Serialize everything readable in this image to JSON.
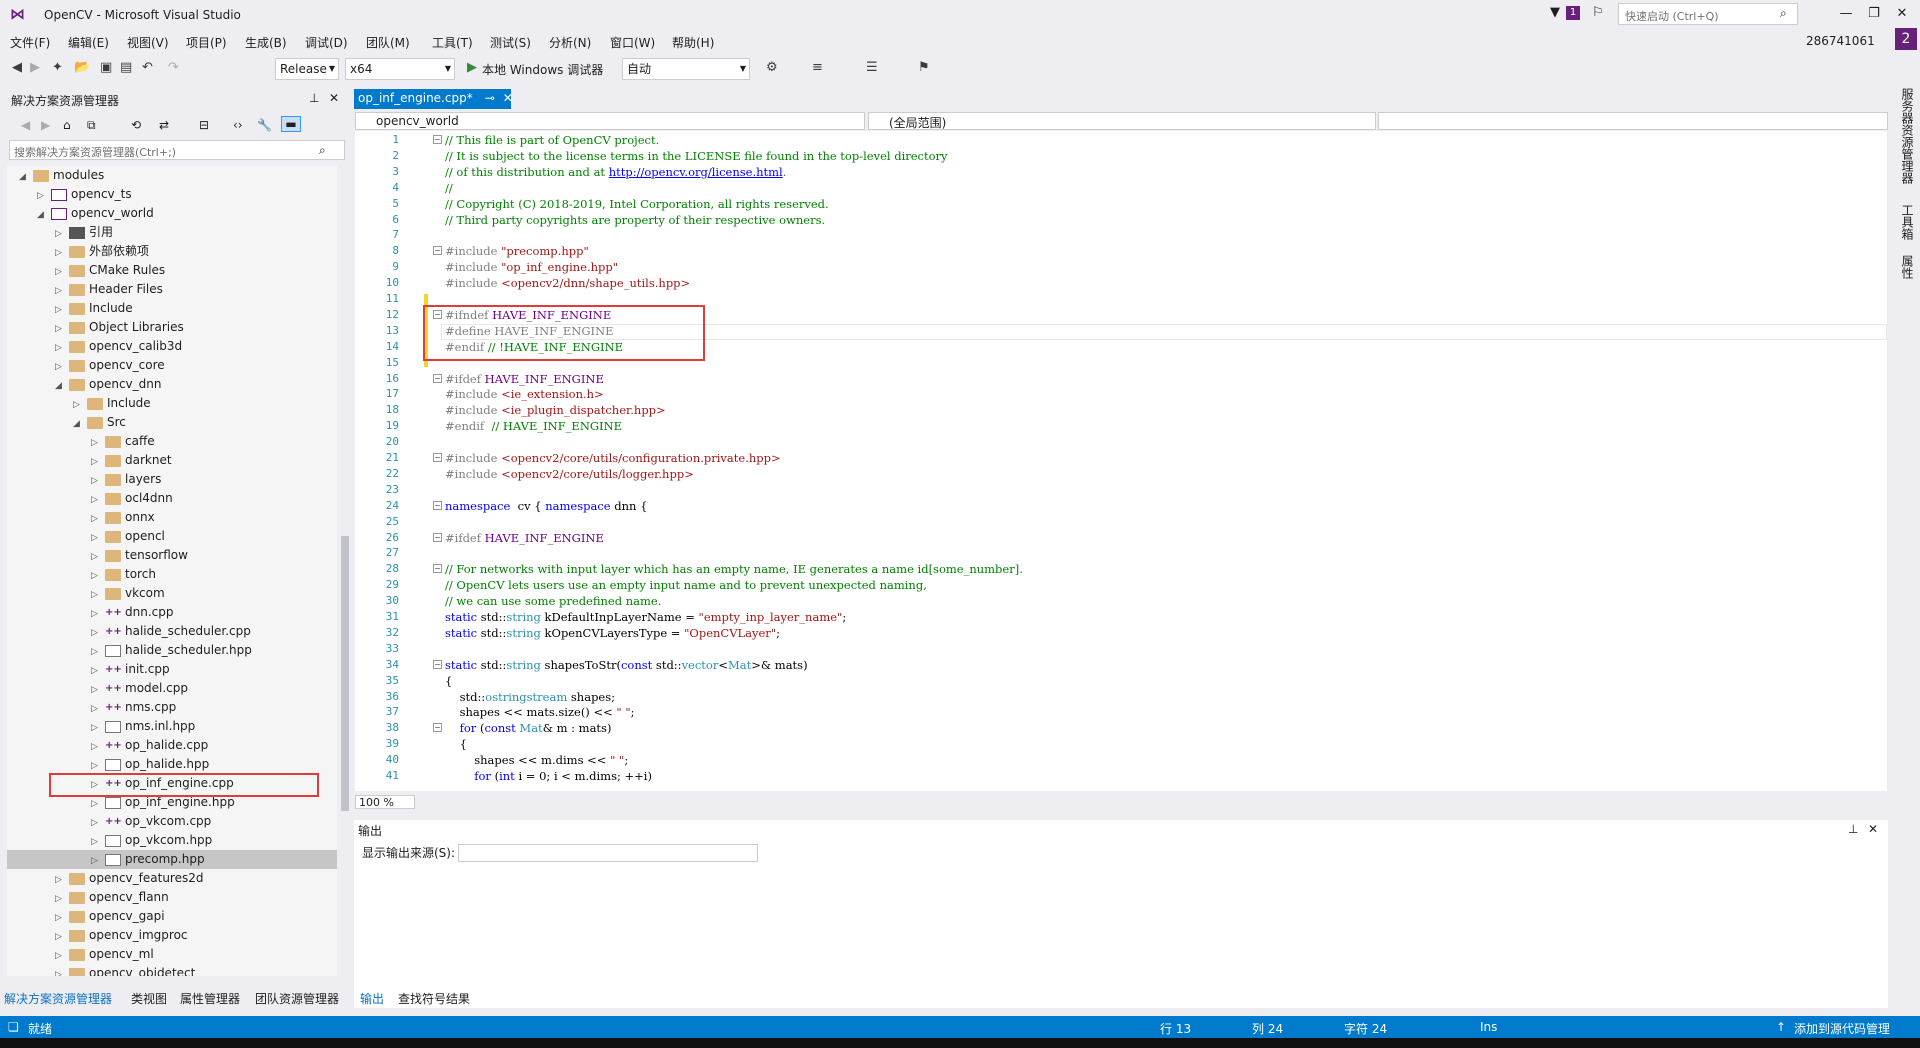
{
  "window": {
    "title": "OpenCV - Microsoft Visual Studio",
    "filter_badge": "1",
    "quick_launch_placeholder": "快速启动 (Ctrl+Q)",
    "user": "286741061",
    "notification": "2"
  },
  "menu": [
    "文件(F)",
    "编辑(E)",
    "视图(V)",
    "项目(P)",
    "生成(B)",
    "调试(D)",
    "团队(M)",
    "工具(T)",
    "测试(S)",
    "分析(N)",
    "窗口(W)",
    "帮助(H)"
  ],
  "toolbar": {
    "config": "Release",
    "platform": "x64",
    "debugger": "本地 Windows 调试器",
    "mode": "自动"
  },
  "solution_explorer": {
    "title": "解决方案资源管理器",
    "search_placeholder": "搜索解决方案资源管理器(Ctrl+;)",
    "tree": [
      {
        "label": "modules",
        "type": "folder",
        "depth": 0,
        "expanded": true
      },
      {
        "label": "opencv_ts",
        "type": "proj",
        "depth": 1,
        "expanded": false
      },
      {
        "label": "opencv_world",
        "type": "proj",
        "depth": 1,
        "expanded": true
      },
      {
        "label": "引用",
        "type": "ref",
        "depth": 2,
        "expanded": false
      },
      {
        "label": "外部依赖项",
        "type": "folder",
        "depth": 2,
        "expanded": false
      },
      {
        "label": "CMake Rules",
        "type": "folder",
        "depth": 2,
        "expanded": false
      },
      {
        "label": "Header Files",
        "type": "folder",
        "depth": 2,
        "expanded": false
      },
      {
        "label": "Include",
        "type": "folder",
        "depth": 2,
        "expanded": false
      },
      {
        "label": "Object Libraries",
        "type": "folder",
        "depth": 2,
        "expanded": false
      },
      {
        "label": "opencv_calib3d",
        "type": "folder",
        "depth": 2,
        "expanded": false
      },
      {
        "label": "opencv_core",
        "type": "folder",
        "depth": 2,
        "expanded": false
      },
      {
        "label": "opencv_dnn",
        "type": "folder",
        "depth": 2,
        "expanded": true
      },
      {
        "label": "Include",
        "type": "folder",
        "depth": 3,
        "expanded": false
      },
      {
        "label": "Src",
        "type": "folder",
        "depth": 3,
        "expanded": true
      },
      {
        "label": "caffe",
        "type": "folder",
        "depth": 4,
        "expanded": false
      },
      {
        "label": "darknet",
        "type": "folder",
        "depth": 4,
        "expanded": false
      },
      {
        "label": "layers",
        "type": "folder",
        "depth": 4,
        "expanded": false
      },
      {
        "label": "ocl4dnn",
        "type": "folder",
        "depth": 4,
        "expanded": false
      },
      {
        "label": "onnx",
        "type": "folder",
        "depth": 4,
        "expanded": false
      },
      {
        "label": "opencl",
        "type": "folder",
        "depth": 4,
        "expanded": false
      },
      {
        "label": "tensorflow",
        "type": "folder",
        "depth": 4,
        "expanded": false
      },
      {
        "label": "torch",
        "type": "folder",
        "depth": 4,
        "expanded": false
      },
      {
        "label": "vkcom",
        "type": "folder",
        "depth": 4,
        "expanded": false
      },
      {
        "label": "dnn.cpp",
        "type": "cpp",
        "depth": 4,
        "expanded": false
      },
      {
        "label": "halide_scheduler.cpp",
        "type": "cpp",
        "depth": 4,
        "expanded": false
      },
      {
        "label": "halide_scheduler.hpp",
        "type": "hpp",
        "depth": 4,
        "expanded": false
      },
      {
        "label": "init.cpp",
        "type": "cpp",
        "depth": 4,
        "expanded": false
      },
      {
        "label": "model.cpp",
        "type": "cpp",
        "depth": 4,
        "expanded": false
      },
      {
        "label": "nms.cpp",
        "type": "cpp",
        "depth": 4,
        "expanded": false
      },
      {
        "label": "nms.inl.hpp",
        "type": "hpp",
        "depth": 4,
        "expanded": false
      },
      {
        "label": "op_halide.cpp",
        "type": "cpp",
        "depth": 4,
        "expanded": false
      },
      {
        "label": "op_halide.hpp",
        "type": "hpp",
        "depth": 4,
        "expanded": false
      },
      {
        "label": "op_inf_engine.cpp",
        "type": "cpp",
        "depth": 4,
        "expanded": false
      },
      {
        "label": "op_inf_engine.hpp",
        "type": "hpp",
        "depth": 4,
        "expanded": false
      },
      {
        "label": "op_vkcom.cpp",
        "type": "cpp",
        "depth": 4,
        "expanded": false
      },
      {
        "label": "op_vkcom.hpp",
        "type": "hpp",
        "depth": 4,
        "expanded": false
      },
      {
        "label": "precomp.hpp",
        "type": "hpp",
        "depth": 4,
        "expanded": false
      },
      {
        "label": "opencv_features2d",
        "type": "folder",
        "depth": 2,
        "expanded": false
      },
      {
        "label": "opencv_flann",
        "type": "folder",
        "depth": 2,
        "expanded": false
      },
      {
        "label": "opencv_gapi",
        "type": "folder",
        "depth": 2,
        "expanded": false
      },
      {
        "label": "opencv_imgproc",
        "type": "folder",
        "depth": 2,
        "expanded": false
      },
      {
        "label": "opencv_ml",
        "type": "folder",
        "depth": 2,
        "expanded": false
      },
      {
        "label": "opencv_objdetect",
        "type": "folder",
        "depth": 2,
        "expanded": false
      }
    ],
    "tabs": [
      "解决方案资源管理器",
      "类视图",
      "属性管理器",
      "团队资源管理器"
    ]
  },
  "editor": {
    "tab": "op_inf_engine.cpp*",
    "nav_project": "opencv_world",
    "nav_scope": "(全局范围)",
    "zoom": "100 %",
    "lines": [
      [
        [
          "c-com",
          "// This file is part of OpenCV project."
        ]
      ],
      [
        [
          "c-com",
          "// It is subject to the license terms in the LICENSE file found in the top-level directory"
        ]
      ],
      [
        [
          "c-com",
          "// of this distribution and at "
        ],
        [
          "c-link",
          "http://opencv.org/license.html"
        ],
        [
          "c-com",
          "."
        ]
      ],
      [
        [
          "c-com",
          "//"
        ]
      ],
      [
        [
          "c-com",
          "// Copyright (C) 2018-2019, Intel Corporation, all rights reserved."
        ]
      ],
      [
        [
          "c-com",
          "// Third party copyrights are property of their respective owners."
        ]
      ],
      [],
      [
        [
          "c-pp",
          "#include "
        ],
        [
          "c-inc",
          "\"precomp.hpp\""
        ]
      ],
      [
        [
          "c-pp",
          "#include "
        ],
        [
          "c-inc",
          "\"op_inf_engine.hpp\""
        ]
      ],
      [
        [
          "c-pp",
          "#include "
        ],
        [
          "c-inc",
          "<opencv2/dnn/shape_utils.hpp>"
        ]
      ],
      [],
      [
        [
          "c-pp",
          "#ifndef "
        ],
        [
          "c-mac",
          "HAVE_INF_ENGINE"
        ]
      ],
      [
        [
          "c-pp",
          "#define HAVE_INF_ENGINE"
        ]
      ],
      [
        [
          "c-pp",
          "#endif "
        ],
        [
          "c-com",
          "// !HAVE_INF_ENGINE"
        ]
      ],
      [],
      [
        [
          "c-pp",
          "#ifdef "
        ],
        [
          "c-mac",
          "HAVE_INF_ENGINE"
        ]
      ],
      [
        [
          "c-pp",
          "#include "
        ],
        [
          "c-inc",
          "<ie_extension.h>"
        ]
      ],
      [
        [
          "c-pp",
          "#include "
        ],
        [
          "c-inc",
          "<ie_plugin_dispatcher.hpp>"
        ]
      ],
      [
        [
          "c-pp",
          "#endif "
        ],
        [
          "c-com",
          " // HAVE_INF_ENGINE"
        ]
      ],
      [],
      [
        [
          "c-pp",
          "#include "
        ],
        [
          "c-inc",
          "<opencv2/core/utils/configuration.private.hpp>"
        ]
      ],
      [
        [
          "c-pp",
          "#include "
        ],
        [
          "c-inc",
          "<opencv2/core/utils/logger.hpp>"
        ]
      ],
      [],
      [
        [
          "c-kw",
          "namespace"
        ],
        [
          "",
          "  cv { "
        ],
        [
          "c-kw",
          "namespace"
        ],
        [
          "",
          " dnn {"
        ]
      ],
      [],
      [
        [
          "c-pp",
          "#ifdef "
        ],
        [
          "c-mac",
          "HAVE_INF_ENGINE"
        ]
      ],
      [],
      [
        [
          "c-com",
          "// For networks with input layer which has an empty name, IE generates a name id[some_number]."
        ]
      ],
      [
        [
          "c-com",
          "// OpenCV lets users use an empty input name and to prevent unexpected naming,"
        ]
      ],
      [
        [
          "c-com",
          "// we can use some predefined name."
        ]
      ],
      [
        [
          "c-kw",
          "static"
        ],
        [
          "",
          " std::"
        ],
        [
          "c-typ",
          "string"
        ],
        [
          "",
          " kDefaultInpLayerName = "
        ],
        [
          "c-str",
          "\"empty_inp_layer_name\""
        ],
        [
          "",
          ";"
        ]
      ],
      [
        [
          "c-kw",
          "static"
        ],
        [
          "",
          " std::"
        ],
        [
          "c-typ",
          "string"
        ],
        [
          "",
          " kOpenCVLayersType = "
        ],
        [
          "c-str",
          "\"OpenCVLayer\""
        ],
        [
          "",
          ";"
        ]
      ],
      [],
      [
        [
          "c-kw",
          "static"
        ],
        [
          "",
          " std::"
        ],
        [
          "c-typ",
          "string"
        ],
        [
          "",
          " shapesToStr("
        ],
        [
          "c-kw",
          "const"
        ],
        [
          "",
          " std::"
        ],
        [
          "c-typ",
          "vector"
        ],
        [
          "",
          "<"
        ],
        [
          "c-typ",
          "Mat"
        ],
        [
          "",
          ">& mats)"
        ]
      ],
      [
        [
          "",
          "{"
        ]
      ],
      [
        [
          "",
          "    std::"
        ],
        [
          "c-typ",
          "ostringstream"
        ],
        [
          "",
          " shapes;"
        ]
      ],
      [
        [
          "",
          "    shapes << mats.size() << "
        ],
        [
          "c-str",
          "\" \""
        ],
        [
          "",
          ";"
        ]
      ],
      [
        [
          "",
          "    "
        ],
        [
          "c-kw",
          "for"
        ],
        [
          "",
          " ("
        ],
        [
          "c-kw",
          "const"
        ],
        [
          "",
          " "
        ],
        [
          "c-typ",
          "Mat"
        ],
        [
          "",
          "& m : mats)"
        ]
      ],
      [
        [
          "",
          "    {"
        ]
      ],
      [
        [
          "",
          "        shapes << m.dims << "
        ],
        [
          "c-str",
          "\" \""
        ],
        [
          "",
          ";"
        ]
      ],
      [
        [
          "",
          "        "
        ],
        [
          "c-kw",
          "for"
        ],
        [
          "",
          " ("
        ],
        [
          "c-kw",
          "int"
        ],
        [
          "",
          " i = 0; i < m.dims; ++i)"
        ]
      ]
    ]
  },
  "output": {
    "title": "输出",
    "source_label": "显示输出来源(S):",
    "tabs": [
      "输出",
      "查找符号结果"
    ]
  },
  "status": {
    "ready": "就绪",
    "line": "行 13",
    "col": "列 24",
    "char": "字符 24",
    "ins": "Ins",
    "source_control": "添加到源代码管理"
  },
  "right_rail": [
    "服务器资源管理器",
    "工具箱",
    "属性"
  ]
}
